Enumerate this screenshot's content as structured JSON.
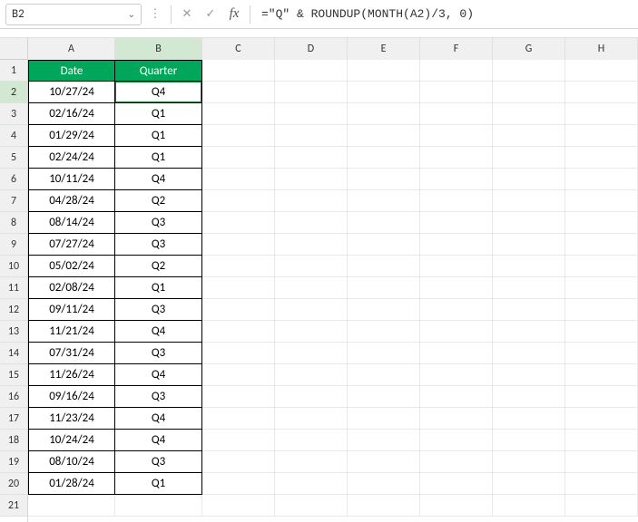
{
  "nameBox": {
    "value": "B2"
  },
  "formulaBar": {
    "value": "=\"Q\" & ROUNDUP(MONTH(A2)/3, 0)"
  },
  "columns": [
    "A",
    "B",
    "C",
    "D",
    "E",
    "F",
    "G",
    "H"
  ],
  "rowNumbers": [
    "1",
    "2",
    "3",
    "4",
    "5",
    "6",
    "7",
    "8",
    "9",
    "10",
    "11",
    "12",
    "13",
    "14",
    "15",
    "16",
    "17",
    "18",
    "19",
    "20",
    "21"
  ],
  "headers": {
    "A": "Date",
    "B": "Quarter"
  },
  "rows": [
    {
      "date": "10/27/24",
      "quarter": "Q4"
    },
    {
      "date": "02/16/24",
      "quarter": "Q1"
    },
    {
      "date": "01/29/24",
      "quarter": "Q1"
    },
    {
      "date": "02/24/24",
      "quarter": "Q1"
    },
    {
      "date": "10/11/24",
      "quarter": "Q4"
    },
    {
      "date": "04/28/24",
      "quarter": "Q2"
    },
    {
      "date": "08/14/24",
      "quarter": "Q3"
    },
    {
      "date": "07/27/24",
      "quarter": "Q3"
    },
    {
      "date": "05/02/24",
      "quarter": "Q2"
    },
    {
      "date": "02/08/24",
      "quarter": "Q1"
    },
    {
      "date": "09/11/24",
      "quarter": "Q3"
    },
    {
      "date": "11/21/24",
      "quarter": "Q4"
    },
    {
      "date": "07/31/24",
      "quarter": "Q3"
    },
    {
      "date": "11/26/24",
      "quarter": "Q4"
    },
    {
      "date": "09/16/24",
      "quarter": "Q3"
    },
    {
      "date": "11/23/24",
      "quarter": "Q4"
    },
    {
      "date": "10/24/24",
      "quarter": "Q4"
    },
    {
      "date": "08/10/24",
      "quarter": "Q3"
    },
    {
      "date": "01/28/24",
      "quarter": "Q1"
    }
  ],
  "selectedCell": "B2",
  "icons": {
    "cancel": "✕",
    "accept": "✓",
    "fx": "fx",
    "chevron": "⌄",
    "dots": "⋮"
  }
}
